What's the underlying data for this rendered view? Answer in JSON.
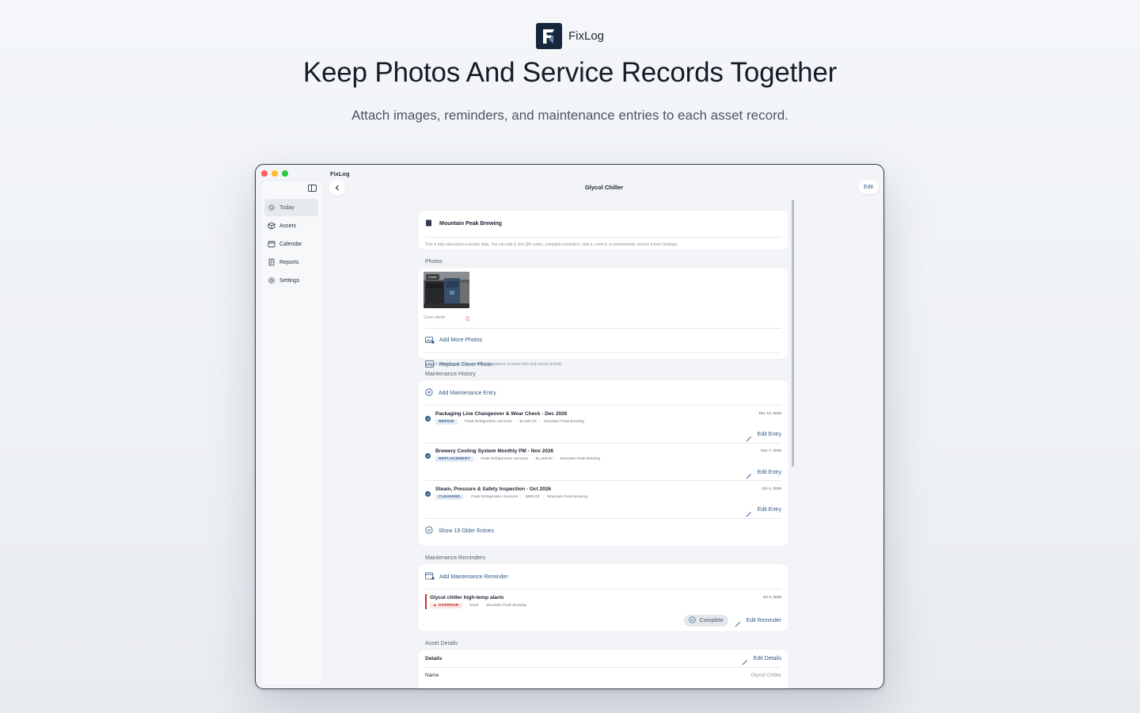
{
  "hero": {
    "brand": "FixLog",
    "title": "Keep Photos And Service Records Together",
    "subtitle": "Attach images, reminders, and maintenance entries to each asset record."
  },
  "window": {
    "app_title": "FixLog",
    "page_title": "Glycol Chiller",
    "edit_label": "Edit"
  },
  "sidebar": {
    "items": [
      {
        "label": "Today",
        "icon": "sun-icon",
        "active": true
      },
      {
        "label": "Assets",
        "icon": "cube-icon"
      },
      {
        "label": "Calendar",
        "icon": "calendar-icon"
      },
      {
        "label": "Reports",
        "icon": "report-icon"
      },
      {
        "label": "Settings",
        "icon": "gear-icon"
      }
    ]
  },
  "org": {
    "name": "Mountain Peak Brewing",
    "note": "This is fully interactive example data. You can edit it, test QR codes, complete reminders, hide it, reset it, or permanently remove it from Settings."
  },
  "photos": {
    "heading": "Photos",
    "cover_tag": "Cover",
    "cover_caption": "Cover photo",
    "add_more": "Add More Photos",
    "replace_cover": "Replace Cover Photo",
    "footnote": "1 of 10 photos used. The cover photo appears in asset lists and recent activity."
  },
  "history": {
    "heading": "Maintenance History",
    "add_label": "Add Maintenance Entry",
    "edit_label": "Edit Entry",
    "entries": [
      {
        "title": "Packaging Line Changeover & Wear Check - Dec 2026",
        "badge": "REPAIR",
        "vendor": "Peak Refrigeration Services",
        "cost": "$1,001.00",
        "site": "Mountain Peak Brewing",
        "date": "Dec 10, 2026"
      },
      {
        "title": "Brewery Cooling System Monthly PM - Nov 2026",
        "badge": "REPLACEMENT",
        "vendor": "Peak Refrigeration Services",
        "cost": "$1,553.60",
        "site": "Mountain Peak Brewing",
        "date": "Nov 7, 2026"
      },
      {
        "title": "Steam, Pressure & Safety Inspection - Oct 2026",
        "badge": "CLEANING",
        "vendor": "Peak Refrigeration Services",
        "cost": "$600.00",
        "site": "Mountain Peak Brewing",
        "date": "Oct 4, 2026"
      }
    ],
    "show_older": "Show 19 Older Entries"
  },
  "reminders": {
    "heading": "Maintenance Reminders",
    "add_label": "Add Maintenance Reminder",
    "item": {
      "title": "Glycol chiller high-temp alarm",
      "badge": "OVERDUE",
      "assignee": "None",
      "site": "Mountain Peak Brewing",
      "date": "Jul 3, 2026"
    },
    "complete_label": "Complete",
    "edit_label": "Edit Reminder"
  },
  "details": {
    "heading": "Asset Details",
    "card_title": "Details",
    "edit_label": "Edit Details",
    "name_label": "Name",
    "name_value": "Glycol Chiller"
  },
  "colors": {
    "accent": "#2f5a8a",
    "overdue": "#c0392b",
    "brand_dark": "#16263d"
  }
}
